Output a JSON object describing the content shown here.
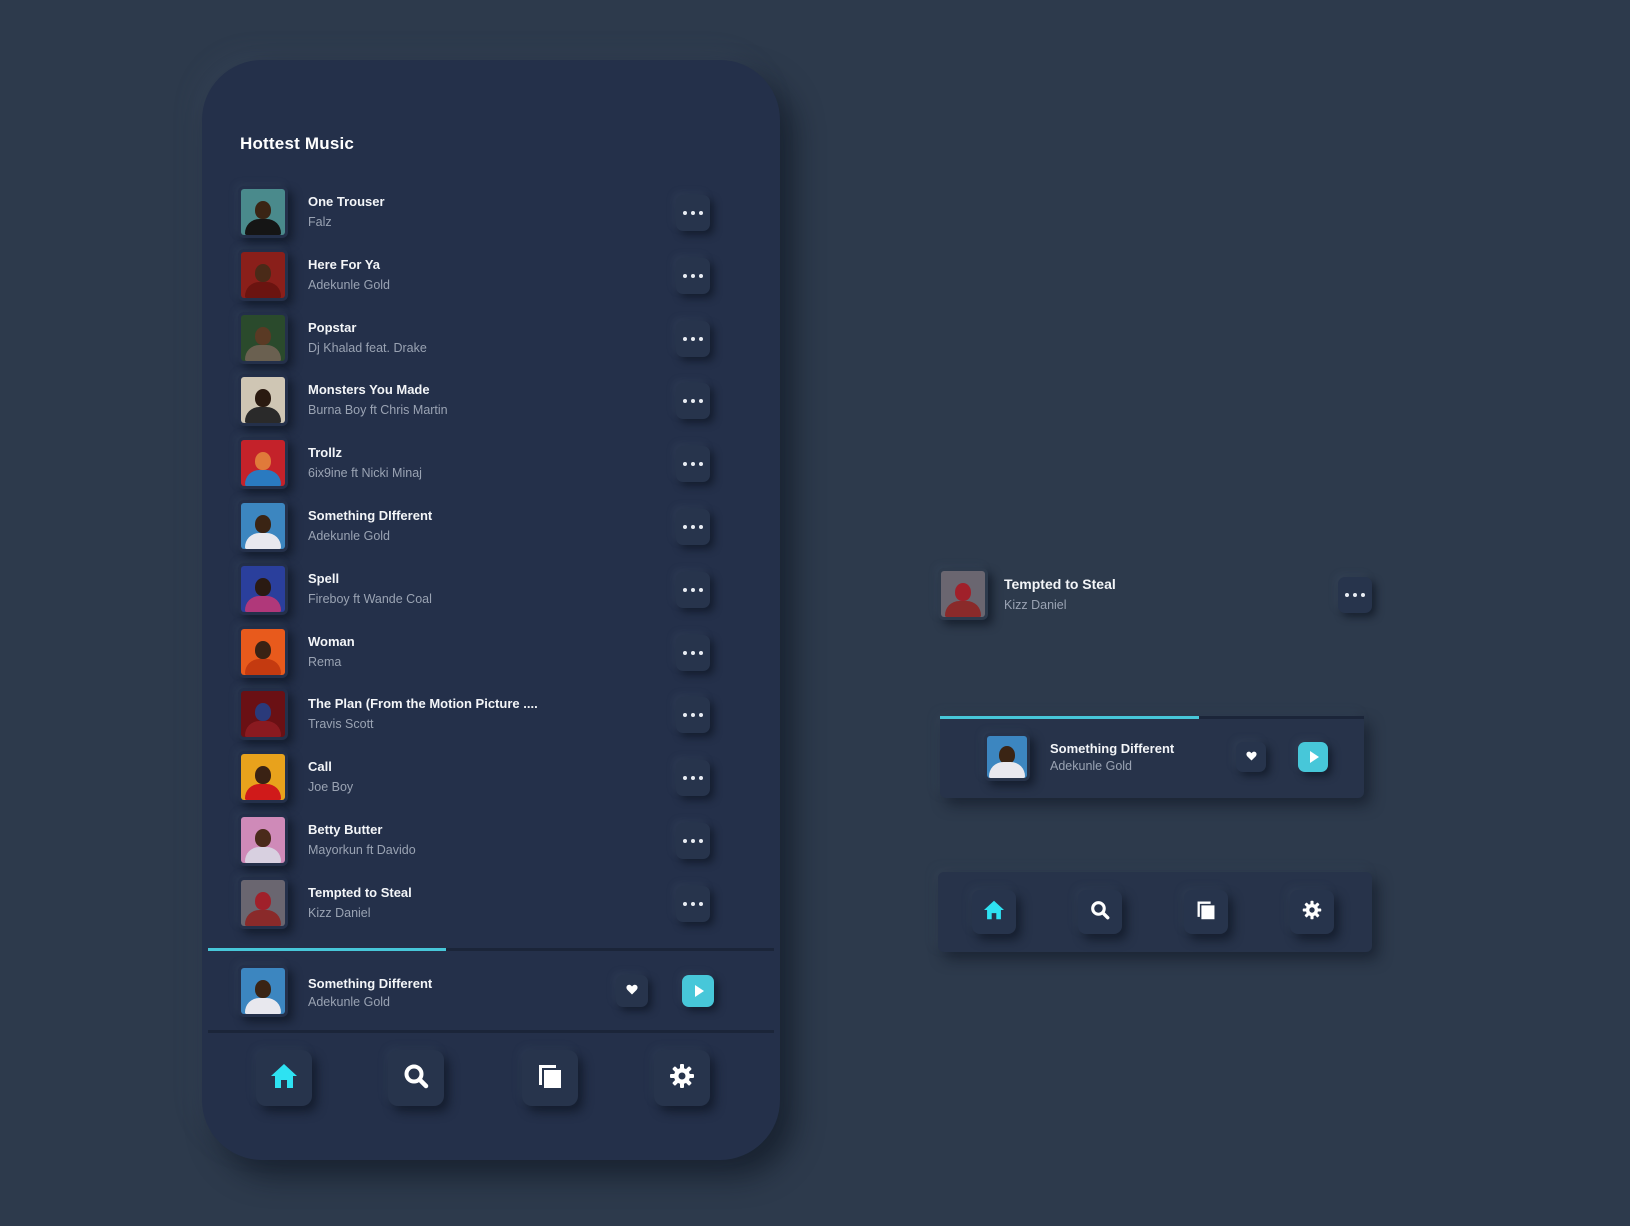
{
  "phone": {
    "title": "Hottest Music",
    "tracks": [
      {
        "title": "One Trouser",
        "artist": "Falz",
        "art": "#4a8a8c",
        "skin": "#3a2414",
        "cloth": "#151515"
      },
      {
        "title": "Here For Ya",
        "artist": "Adekunle Gold",
        "art": "#8a1f1a",
        "skin": "#4a2a18",
        "cloth": "#6b1410"
      },
      {
        "title": "Popstar",
        "artist": "Dj Khalad feat. Drake",
        "art": "#2a4a2c",
        "skin": "#5a3a24",
        "cloth": "#6a6050"
      },
      {
        "title": "Monsters You Made",
        "artist": "Burna Boy ft Chris Martin",
        "art": "#cfc6b4",
        "skin": "#2a1a10",
        "cloth": "#2a2a2a"
      },
      {
        "title": "Trollz",
        "artist": "6ix9ine ft Nicki Minaj",
        "art": "#c4222a",
        "skin": "#e07a3a",
        "cloth": "#2a7ac0"
      },
      {
        "title": "Something DIfferent",
        "artist": "Adekunle Gold",
        "art": "#3c86c0",
        "skin": "#3a2414",
        "cloth": "#e8e8ee"
      },
      {
        "title": "Spell",
        "artist": "Fireboy ft Wande Coal",
        "art": "#2a3f9c",
        "skin": "#2a1a12",
        "cloth": "#b0387a"
      },
      {
        "title": "Woman",
        "artist": "Rema",
        "art": "#e85a1c",
        "skin": "#3a2214",
        "cloth": "#c43a10"
      },
      {
        "title": "The Plan (From the Motion Picture ....",
        "artist": "Travis Scott",
        "art": "#6a1014",
        "skin": "#2a3a7a",
        "cloth": "#8a1a20"
      },
      {
        "title": "Call",
        "artist": "Joe Boy",
        "art": "#e8a21c",
        "skin": "#3a2214",
        "cloth": "#d01a1a"
      },
      {
        "title": "Betty Butter",
        "artist": "Mayorkun ft Davido",
        "art": "#cf8ab8",
        "skin": "#4a2a1a",
        "cloth": "#d8d0e0"
      },
      {
        "title": "Tempted to Steal",
        "artist": "Kizz Daniel",
        "art": "#6a6670",
        "skin": "#a0202a",
        "cloth": "#8a2a2a"
      }
    ],
    "now_playing": {
      "title": "Something Different",
      "artist": "Adekunle Gold",
      "art": "#3c86c0",
      "skin": "#3a2414",
      "cloth": "#e8e8ee",
      "progress": 0.42
    },
    "nav": {
      "home": "home",
      "search": "search",
      "library": "library",
      "settings": "settings"
    }
  },
  "right": {
    "list_item": {
      "title": "Tempted to Steal",
      "artist": "Kizz Daniel",
      "art": "#6a6670",
      "skin": "#a0202a",
      "cloth": "#8a2a2a"
    },
    "player": {
      "title": "Something Different",
      "artist": "Adekunle Gold",
      "art": "#3c86c0",
      "skin": "#3a2414",
      "cloth": "#e8e8ee",
      "progress": 0.61
    }
  },
  "colors": {
    "accent": "#47c7d9",
    "background": "#2d3a4c",
    "surface": "#24304a"
  }
}
